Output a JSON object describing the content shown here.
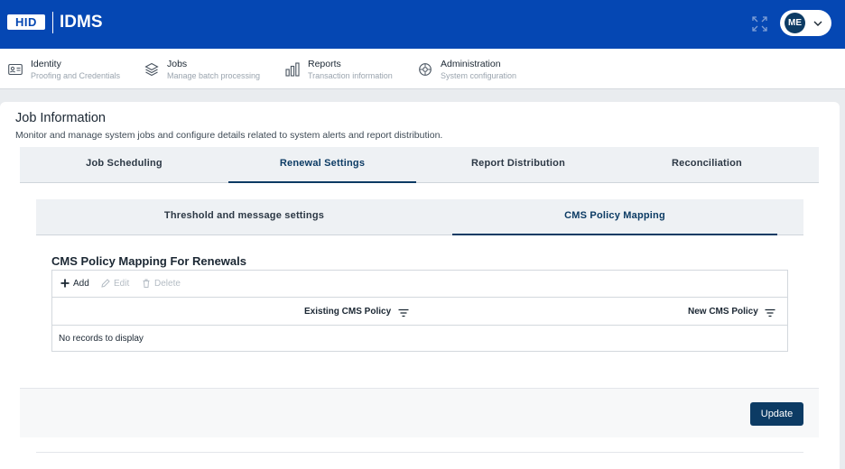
{
  "header": {
    "brand": "HID",
    "app_name": "IDMS",
    "user_initials": "ME"
  },
  "nav": [
    {
      "title": "Identity",
      "subtitle": "Proofing and Credentials",
      "icon": "id-card-icon"
    },
    {
      "title": "Jobs",
      "subtitle": "Manage batch processing",
      "icon": "layers-icon"
    },
    {
      "title": "Reports",
      "subtitle": "Transaction information",
      "icon": "bar-chart-icon"
    },
    {
      "title": "Administration",
      "subtitle": "System configuration",
      "icon": "settings-icon"
    }
  ],
  "page": {
    "title": "Job Information",
    "description": "Monitor and manage system jobs and configure details related to system alerts and report distribution."
  },
  "tabs": [
    {
      "label": "Job Scheduling",
      "active": false
    },
    {
      "label": "Renewal Settings",
      "active": true
    },
    {
      "label": "Report Distribution",
      "active": false
    },
    {
      "label": "Reconciliation",
      "active": false
    }
  ],
  "subtabs": [
    {
      "label": "Threshold and message settings",
      "active": false
    },
    {
      "label": "CMS Policy Mapping",
      "active": true
    }
  ],
  "section": {
    "title": "CMS Policy Mapping For Renewals"
  },
  "grid": {
    "toolbar": {
      "add": "Add",
      "edit": "Edit",
      "delete": "Delete"
    },
    "columns": [
      "Existing CMS Policy",
      "New CMS Policy"
    ],
    "empty_message": "No records to display"
  },
  "footer": {
    "update_label": "Update"
  },
  "colors": {
    "header_blue": "#0547b3",
    "primary_dark": "#0c3b64"
  }
}
